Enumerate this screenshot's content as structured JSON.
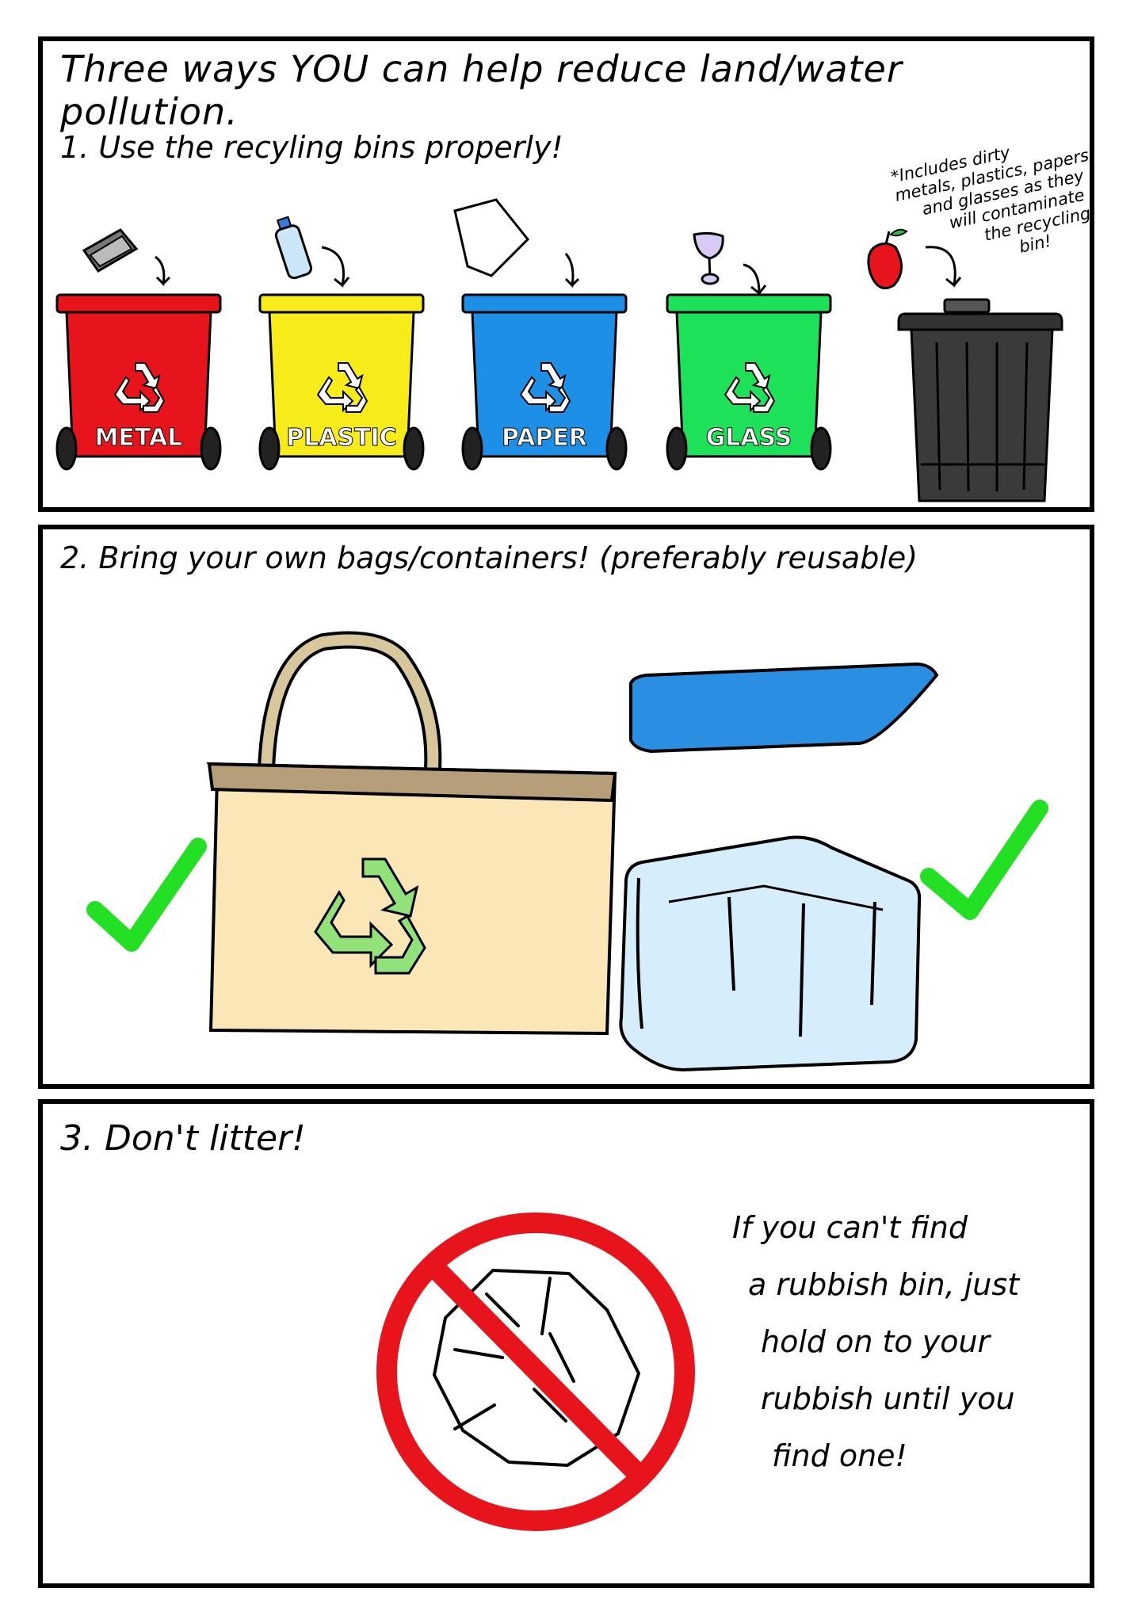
{
  "title": "Three ways YOU can help reduce land/water pollution.",
  "colors": {
    "metal_bin": "#e8141b",
    "plastic_bin": "#f7ec1a",
    "paper_bin": "#1e8fe6",
    "glass_bin": "#1ee15a",
    "general_bin": "#333333",
    "check": "#24e024",
    "no_sign": "#e8141b",
    "bag": "#fbe6b8",
    "recycle_green": "#92e27a",
    "container": "#d6edfb",
    "lid": "#2a8fe0"
  },
  "section1": {
    "heading": "1. Use the recyling bins properly!",
    "note": [
      "*Includes dirty",
      "metals, plastics, papers",
      "and glasses as they",
      "will contaminate",
      "the recycling",
      "bin!"
    ],
    "bins": [
      {
        "label": "METAL",
        "item_icon": "metal-scrap-icon"
      },
      {
        "label": "PLASTIC",
        "item_icon": "plastic-bottle-icon"
      },
      {
        "label": "PAPER",
        "item_icon": "paper-sheet-icon"
      },
      {
        "label": "GLASS",
        "item_icon": "wine-glass-icon"
      }
    ],
    "general_bin_item_icon": "apple-core-icon"
  },
  "section2": {
    "heading": "2. Bring your own bags/containers! (preferably reusable)",
    "items": [
      "tote-bag-icon",
      "food-container-icon"
    ]
  },
  "section3": {
    "heading": "3. Don't litter!",
    "advice": [
      "If you can't find",
      "a rubbish bin, just",
      "hold on to your",
      "rubbish until you",
      "find one!"
    ]
  }
}
